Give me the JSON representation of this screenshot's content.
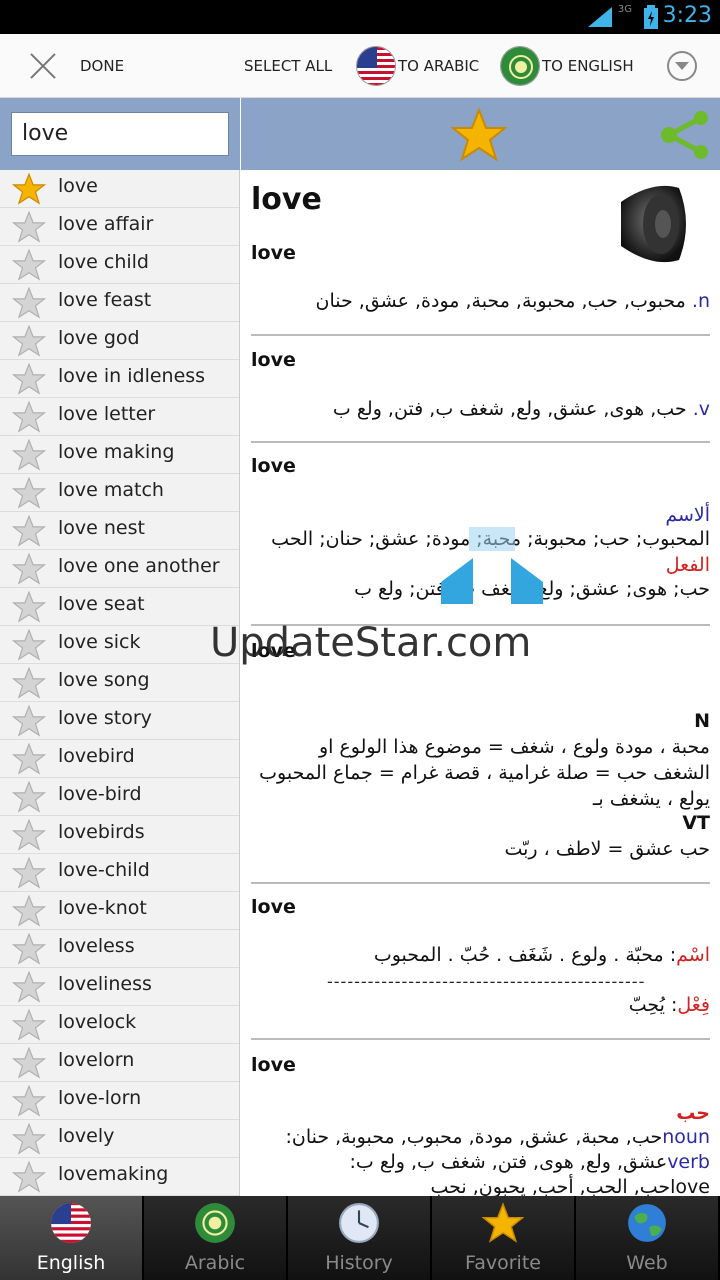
{
  "status_bar": {
    "network": "3G",
    "time": "3:23"
  },
  "action_bar": {
    "done_label": "DONE",
    "select_all_label": "SELECT ALL",
    "to_arabic_label": "TO ARABIC",
    "to_english_label": "TO ENGLISH"
  },
  "search": {
    "value": "love"
  },
  "word_list": [
    {
      "label": "love",
      "favorite": true
    },
    {
      "label": "love affair",
      "favorite": false
    },
    {
      "label": "love child",
      "favorite": false
    },
    {
      "label": "love feast",
      "favorite": false
    },
    {
      "label": "love god",
      "favorite": false
    },
    {
      "label": "love in idleness",
      "favorite": false
    },
    {
      "label": "love letter",
      "favorite": false
    },
    {
      "label": "love making",
      "favorite": false
    },
    {
      "label": "love match",
      "favorite": false
    },
    {
      "label": "love nest",
      "favorite": false
    },
    {
      "label": "love one another",
      "favorite": false
    },
    {
      "label": "love seat",
      "favorite": false
    },
    {
      "label": "love sick",
      "favorite": false
    },
    {
      "label": "love song",
      "favorite": false
    },
    {
      "label": "love story",
      "favorite": false
    },
    {
      "label": "lovebird",
      "favorite": false
    },
    {
      "label": "love-bird",
      "favorite": false
    },
    {
      "label": "lovebirds",
      "favorite": false
    },
    {
      "label": "love-child",
      "favorite": false
    },
    {
      "label": "love-knot",
      "favorite": false
    },
    {
      "label": "loveless",
      "favorite": false
    },
    {
      "label": "loveliness",
      "favorite": false
    },
    {
      "label": "lovelock",
      "favorite": false
    },
    {
      "label": "lovelorn",
      "favorite": false
    },
    {
      "label": "love-lorn",
      "favorite": false
    },
    {
      "label": "lovely",
      "favorite": false
    },
    {
      "label": "lovemaking",
      "favorite": false
    }
  ],
  "content": {
    "headword": "love",
    "entries": {
      "e1": {
        "word": "love",
        "pos": "n.",
        "text": "محبوب, حب, محبوبة, محبة, مودة, عشق, حنان"
      },
      "e2": {
        "word": "love",
        "pos": "v.",
        "text": "حب, هوى, عشق, ولع, شغف ب, فتن, ولع ب"
      },
      "e3": {
        "word": "love",
        "nouns_label": "ألاسم",
        "nouns_text": "المحبوب; حب; محبوبة; محبة; مودة; عشق; حنان; الحب",
        "verb_label": "الفعل",
        "verb_text": "حب; هوى; عشق; ولع; شغف ب; فتن; ولع ب"
      },
      "e4": {
        "word": "love",
        "n_label": "N",
        "n_line1": "محبة ، مودة ولوع ، شغف = موضوع هذا الولوع او",
        "n_line2": "الشغف حب = صلة غرامية ، قصة غرام = جماع المحبوب",
        "n_line3": "يولع ، يشغف بـ",
        "vt_label": "VT",
        "vt_line": "حب عشق = لاطف ، ربّت"
      },
      "e5": {
        "word": "love",
        "noun_label": "اسْم",
        "noun_text": ":  محبّة . ولوع . شَغَف . حُبّ . المحبوب",
        "dashes": "-----------------------------------------------",
        "verb_label": "فِعْل",
        "verb_text": ": يُحِبّ"
      },
      "e6": {
        "word": "love",
        "arabic_head": "حب",
        "noun_pos": "noun",
        "noun_text": "حب, محبة, عشق, مودة, محبوب, محبوبة, حنان:",
        "verb_pos": "verb",
        "verb_text": "عشق, ولع, هوى, فتن, شغف ب, ولع ب:",
        "love_word": "love",
        "love_text": "حب, الحب, أحب, يحبون, نحب"
      }
    }
  },
  "watermark": "UpdateStar.com",
  "tabs": [
    {
      "label": "English",
      "icon": "us-flag-icon",
      "active": true
    },
    {
      "label": "Arabic",
      "icon": "arab-league-flag-icon",
      "active": false
    },
    {
      "label": "History",
      "icon": "clock-icon",
      "active": false
    },
    {
      "label": "Favorite",
      "icon": "star-icon",
      "active": false
    },
    {
      "label": "Web",
      "icon": "globe-icon",
      "active": false
    }
  ],
  "colors": {
    "accent_blue": "#3fb4ea",
    "panel_blue": "#8aa3c6",
    "pos_blue": "#2a2aa8",
    "label_red": "#d42020",
    "star_gold": "#f5b400"
  }
}
